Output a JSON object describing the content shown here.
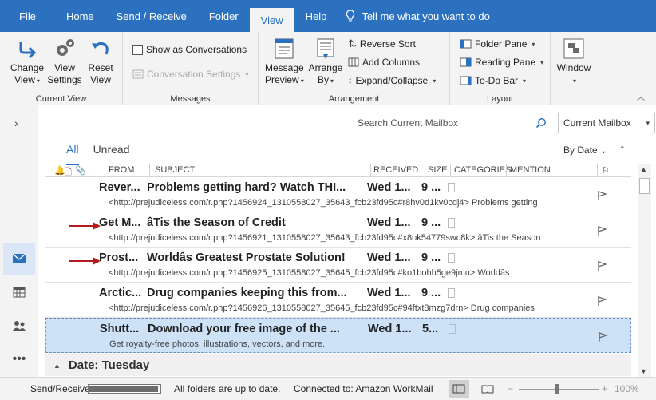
{
  "menu": {
    "tabs": [
      "File",
      "Home",
      "Send / Receive",
      "Folder",
      "View",
      "Help"
    ],
    "active_tab": "View",
    "tell_me": "Tell me what you want to do"
  },
  "ribbon": {
    "current_view": {
      "label": "Current View",
      "change_view": [
        "Change",
        "View"
      ],
      "view_settings": [
        "View",
        "Settings"
      ],
      "reset_view": [
        "Reset",
        "View"
      ]
    },
    "messages": {
      "label": "Messages",
      "show_as_conversations": "Show as Conversations",
      "conversation_settings": "Conversation Settings"
    },
    "arrangement": {
      "label": "Arrangement",
      "message_preview": [
        "Message",
        "Preview"
      ],
      "arrange_by": [
        "Arrange",
        "By"
      ],
      "reverse_sort": "Reverse Sort",
      "add_columns": "Add Columns",
      "expand_collapse": "Expand/Collapse"
    },
    "layout": {
      "label": "Layout",
      "folder_pane": "Folder Pane",
      "reading_pane": "Reading Pane",
      "todo_bar": "To-Do Bar"
    },
    "window": {
      "label": "Window"
    }
  },
  "search": {
    "placeholder": "Search Current Mailbox",
    "scope": "Current Mailbox"
  },
  "filters": {
    "all": "All",
    "unread": "Unread",
    "sort_by": "By Date"
  },
  "columns": {
    "from": "FROM",
    "subject": "SUBJECT",
    "received": "RECEIVED",
    "size": "SIZE",
    "categories": "CATEGORIES",
    "mention": "MENTION"
  },
  "messages": [
    {
      "from": "Rever...",
      "subject": "Problems getting hard? Watch THI...",
      "received": "Wed 1...",
      "size": "9 ...",
      "preview": "<http://prejudiceless.com/r.php?1456924_1310558027_35643_fcb23fd95c#r8hv0d1kv0cdj4>   Problems getting",
      "arrow": false,
      "selected": false
    },
    {
      "from": "Get M...",
      "subject": "âTis the Season of Credit",
      "received": "Wed 1...",
      "size": "9 ...",
      "preview": "<http://prejudiceless.com/r.php?1456921_1310558027_35643_fcb23fd95c#x8ok54779swc8k>   âTis the Season",
      "arrow": true,
      "selected": false
    },
    {
      "from": "Prost...",
      "subject": "Worldâs Greatest Prostate Solution!",
      "received": "Wed 1...",
      "size": "9 ...",
      "preview": "<http://prejudiceless.com/r.php?1456925_1310558027_35645_fcb23fd95c#ko1bohh5ge9jmu>   Worldâs",
      "arrow": true,
      "selected": false
    },
    {
      "from": "Arctic...",
      "subject": "Drug companies keeping this from...",
      "received": "Wed 1...",
      "size": "9 ...",
      "preview": "<http://prejudiceless.com/r.php?1456926_1310558027_35645_fcb23fd95c#94ftxt8mzg7drn>   Drug companies",
      "arrow": false,
      "selected": false
    },
    {
      "from": "Shutt...",
      "subject": "Download your free image of the ...",
      "received": "Wed 1...",
      "size": "5...",
      "preview": "Get royalty-free photos, illustrations, vectors, and more.",
      "arrow": false,
      "selected": true
    }
  ],
  "date_group": "Date: Tuesday",
  "status": {
    "send_receive": "Send/Receive",
    "progress": 0.95,
    "folders": "All folders are up to date.",
    "connected": "Connected to: Amazon WorkMail",
    "zoom": "100%"
  },
  "colors": {
    "accent": "#2b71c0",
    "selected_row": "#cde1f7",
    "arrow": "#b01c1c"
  }
}
